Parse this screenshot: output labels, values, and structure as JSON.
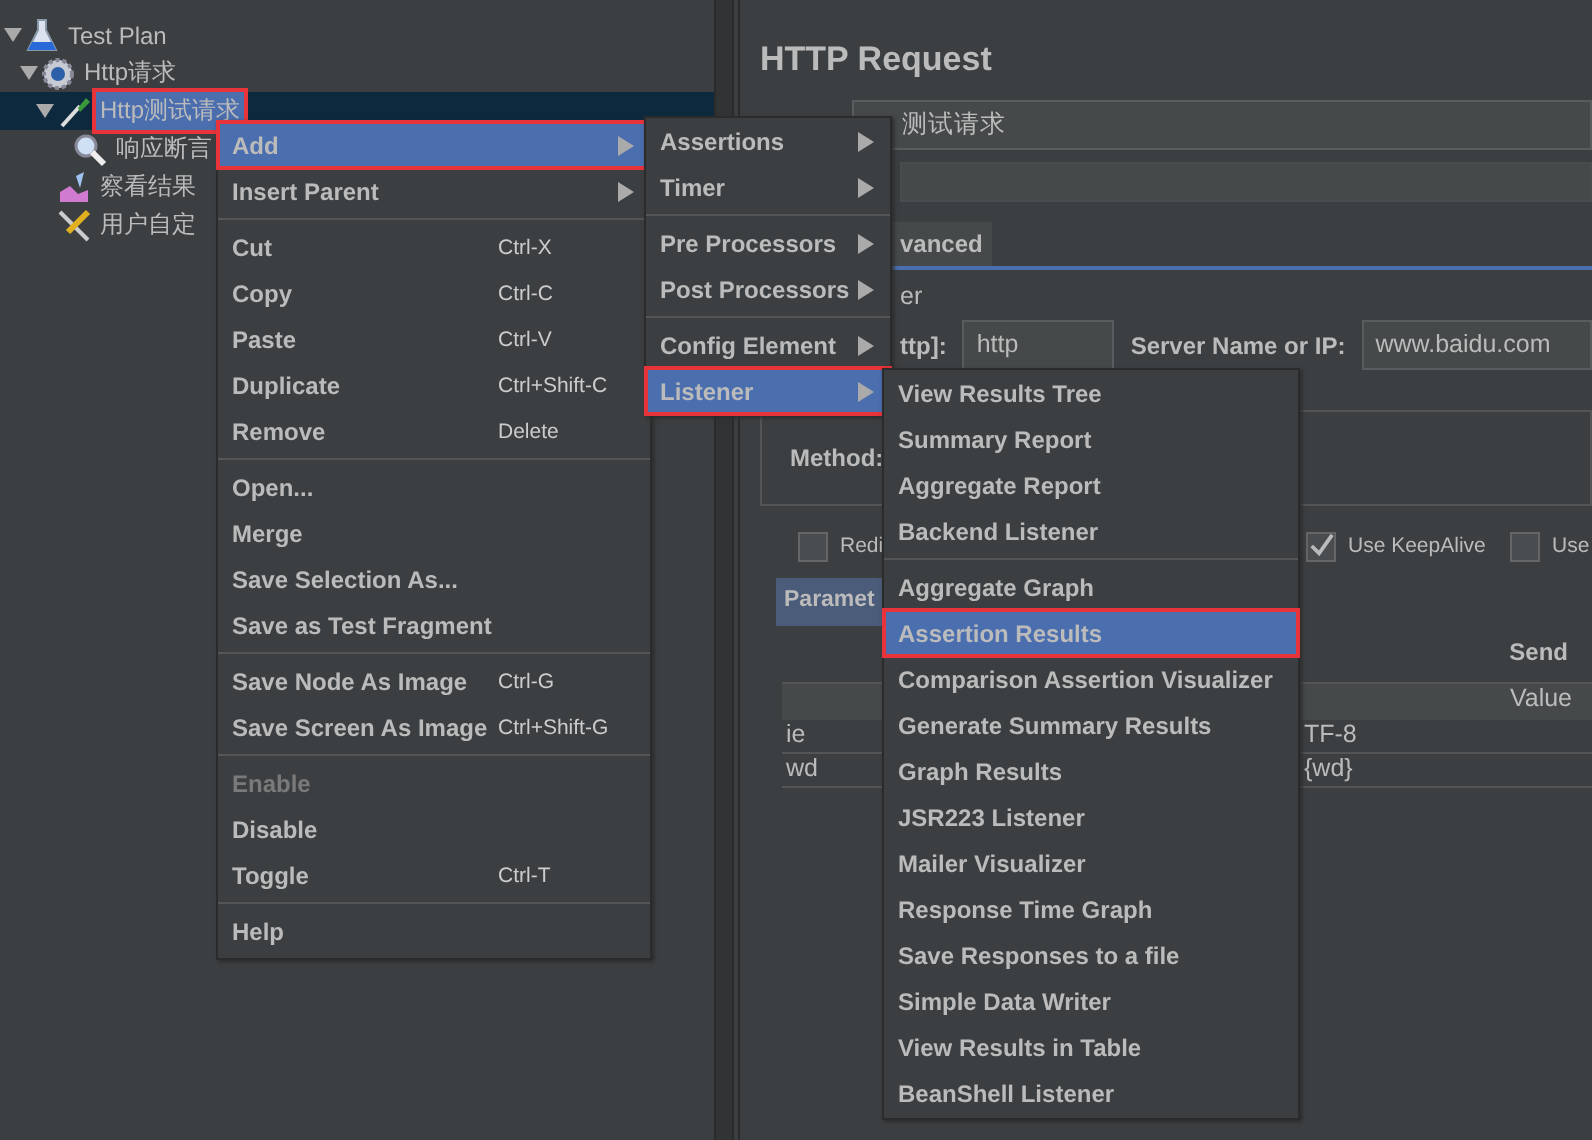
{
  "tree": [
    {
      "label": "Test Plan",
      "kind": "plan",
      "expanded": true,
      "selected": false,
      "marked": false,
      "children": [
        {
          "label": "Http请求",
          "kind": "thread",
          "expanded": true,
          "selected": false,
          "marked": false,
          "children": [
            {
              "label": "Http测试请求",
              "kind": "sampler",
              "expanded": true,
              "selected": true,
              "marked": true,
              "children": [
                {
                  "label": "响应断言",
                  "kind": "assertion",
                  "selected": false,
                  "marked": false
                }
              ]
            },
            {
              "label": "察看结果",
              "kind": "listener",
              "selected": false,
              "marked": false
            },
            {
              "label": "用户自定",
              "kind": "config",
              "selected": false,
              "marked": false
            }
          ]
        }
      ]
    }
  ],
  "editor": {
    "title": "HTTP Request",
    "name_value": "测试请求",
    "tab": "vanced",
    "section": "er",
    "protocol_label": "ttp]:",
    "protocol_value": "http",
    "server_label": "Server Name or IP:",
    "server_value": "www.baidu.com",
    "method_label": "Method:",
    "options": [
      {
        "label": "Redi",
        "checked": false
      },
      {
        "label": "Use KeepAlive",
        "checked": true
      },
      {
        "label": "Use",
        "checked": false
      }
    ],
    "params_tab": "Paramet",
    "send_label": "Send",
    "value_heading": "Value",
    "rows": [
      [
        "ie",
        "TF-8"
      ],
      [
        "wd",
        "{wd}"
      ]
    ]
  },
  "context_menu": {
    "groups": [
      [
        {
          "label": "Add",
          "submenu": true,
          "selected": true,
          "marked": true,
          "disabled": false
        },
        {
          "label": "Insert Parent",
          "submenu": true,
          "selected": false,
          "marked": false,
          "disabled": false
        }
      ],
      [
        {
          "label": "Cut",
          "shortcut": "Ctrl-X",
          "selected": false,
          "marked": false,
          "disabled": false
        },
        {
          "label": "Copy",
          "shortcut": "Ctrl-C",
          "selected": false,
          "marked": false,
          "disabled": false
        },
        {
          "label": "Paste",
          "shortcut": "Ctrl-V",
          "selected": false,
          "marked": false,
          "disabled": false
        },
        {
          "label": "Duplicate",
          "shortcut": "Ctrl+Shift-C",
          "selected": false,
          "marked": false,
          "disabled": false
        },
        {
          "label": "Remove",
          "shortcut": "Delete",
          "selected": false,
          "marked": false,
          "disabled": false
        }
      ],
      [
        {
          "label": "Open...",
          "selected": false,
          "marked": false,
          "disabled": false
        },
        {
          "label": "Merge",
          "selected": false,
          "marked": false,
          "disabled": false
        },
        {
          "label": "Save Selection As...",
          "selected": false,
          "marked": false,
          "disabled": false
        },
        {
          "label": "Save as Test Fragment",
          "selected": false,
          "marked": false,
          "disabled": false
        }
      ],
      [
        {
          "label": "Save Node As Image",
          "shortcut": "Ctrl-G",
          "selected": false,
          "marked": false,
          "disabled": false
        },
        {
          "label": "Save Screen As Image",
          "shortcut": "Ctrl+Shift-G",
          "selected": false,
          "marked": false,
          "disabled": false
        }
      ],
      [
        {
          "label": "Enable",
          "selected": false,
          "marked": false,
          "disabled": true
        },
        {
          "label": "Disable",
          "selected": false,
          "marked": false,
          "disabled": false
        },
        {
          "label": "Toggle",
          "shortcut": "Ctrl-T",
          "selected": false,
          "marked": false,
          "disabled": false
        }
      ],
      [
        {
          "label": "Help",
          "selected": false,
          "marked": false,
          "disabled": false
        }
      ]
    ]
  },
  "add_menu": {
    "groups": [
      [
        {
          "label": "Assertions",
          "submenu": true,
          "selected": false,
          "marked": false
        },
        {
          "label": "Timer",
          "submenu": true,
          "selected": false,
          "marked": false
        }
      ],
      [
        {
          "label": "Pre Processors",
          "submenu": true,
          "selected": false,
          "marked": false
        },
        {
          "label": "Post Processors",
          "submenu": true,
          "selected": false,
          "marked": false
        }
      ],
      [
        {
          "label": "Config Element",
          "submenu": true,
          "selected": false,
          "marked": false
        },
        {
          "label": "Listener",
          "submenu": true,
          "selected": true,
          "marked": true
        }
      ]
    ]
  },
  "listener_menu": {
    "groups": [
      [
        {
          "label": "View Results Tree",
          "selected": false,
          "marked": false
        },
        {
          "label": "Summary Report",
          "selected": false,
          "marked": false
        },
        {
          "label": "Aggregate Report",
          "selected": false,
          "marked": false
        },
        {
          "label": "Backend Listener",
          "selected": false,
          "marked": false
        }
      ],
      [
        {
          "label": "Aggregate Graph",
          "selected": false,
          "marked": false
        },
        {
          "label": "Assertion Results",
          "selected": true,
          "marked": true
        },
        {
          "label": "Comparison Assertion Visualizer",
          "selected": false,
          "marked": false
        },
        {
          "label": "Generate Summary Results",
          "selected": false,
          "marked": false
        },
        {
          "label": "Graph Results",
          "selected": false,
          "marked": false
        },
        {
          "label": "JSR223 Listener",
          "selected": false,
          "marked": false
        },
        {
          "label": "Mailer Visualizer",
          "selected": false,
          "marked": false
        },
        {
          "label": "Response Time Graph",
          "selected": false,
          "marked": false
        },
        {
          "label": "Save Responses to a file",
          "selected": false,
          "marked": false
        },
        {
          "label": "Simple Data Writer",
          "selected": false,
          "marked": false
        },
        {
          "label": "View Results in Table",
          "selected": false,
          "marked": false
        },
        {
          "label": "BeanShell Listener",
          "selected": false,
          "marked": false
        }
      ]
    ]
  }
}
